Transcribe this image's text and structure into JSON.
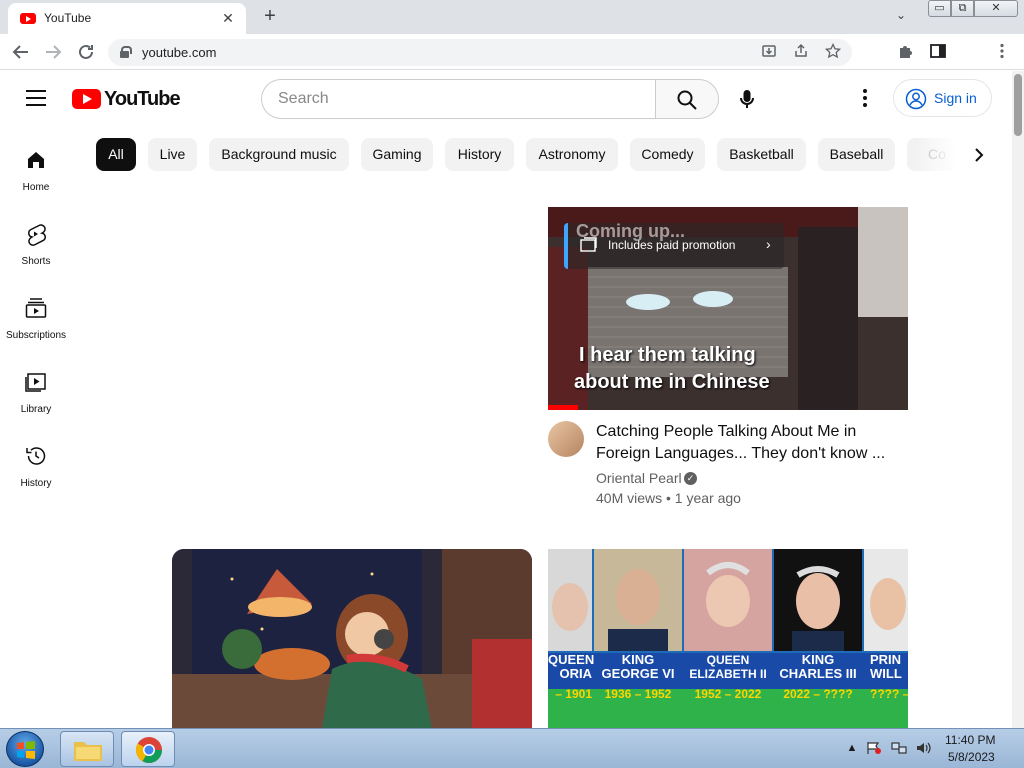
{
  "browser": {
    "tab_title": "YouTube",
    "tab_close": "✕",
    "new_tab": "+",
    "tab_search": "⌄",
    "url": "youtube.com",
    "extension_count": "12",
    "window_min": "▭",
    "window_max": "⧉",
    "window_close": "✕"
  },
  "header": {
    "logo_text": "YouTube",
    "search_placeholder": "Search",
    "signin_label": "Sign in"
  },
  "sidebar": {
    "items": [
      {
        "label": "Home",
        "icon": "home-icon"
      },
      {
        "label": "Shorts",
        "icon": "shorts-icon"
      },
      {
        "label": "Subscriptions",
        "icon": "subscriptions-icon"
      },
      {
        "label": "Library",
        "icon": "library-icon"
      },
      {
        "label": "History",
        "icon": "history-icon"
      }
    ]
  },
  "chips": [
    "All",
    "Live",
    "Background music",
    "Gaming",
    "History",
    "Astronomy",
    "Comedy",
    "Basketball",
    "Baseball",
    "Co"
  ],
  "videos": [
    {
      "thumb_caption": "I hear them talking about me in Chinese",
      "thumb_caption_line1": "I hear them talking",
      "thumb_caption_line2": "about me in Chinese",
      "overlay_coming": "Coming up...",
      "paid_promo": "Includes paid promotion",
      "title": "Catching People Talking About Me in Foreign Languages... They don't know ...",
      "channel": "Oriental Pearl",
      "meta": "40M views • 1 year ago"
    },
    {
      "kings": [
        {
          "name1": "QUEEN",
          "name2": "ORIA",
          "years": "– 1901"
        },
        {
          "name1": "KING",
          "name2": "GEORGE VI",
          "years": "1936 – 1952"
        },
        {
          "name1": "QUEEN",
          "name2": "ELIZABETH II",
          "years": "1952 – 2022"
        },
        {
          "name1": "KING",
          "name2": "CHARLES III",
          "years": "2022 – ????"
        },
        {
          "name1": "PRIN",
          "name2": "WILL",
          "years": "???? –"
        }
      ]
    }
  ],
  "taskbar": {
    "time": "11:40 PM",
    "date": "5/8/2023"
  },
  "colors": {
    "accent": "#065fd4",
    "brand": "#ff0000"
  }
}
